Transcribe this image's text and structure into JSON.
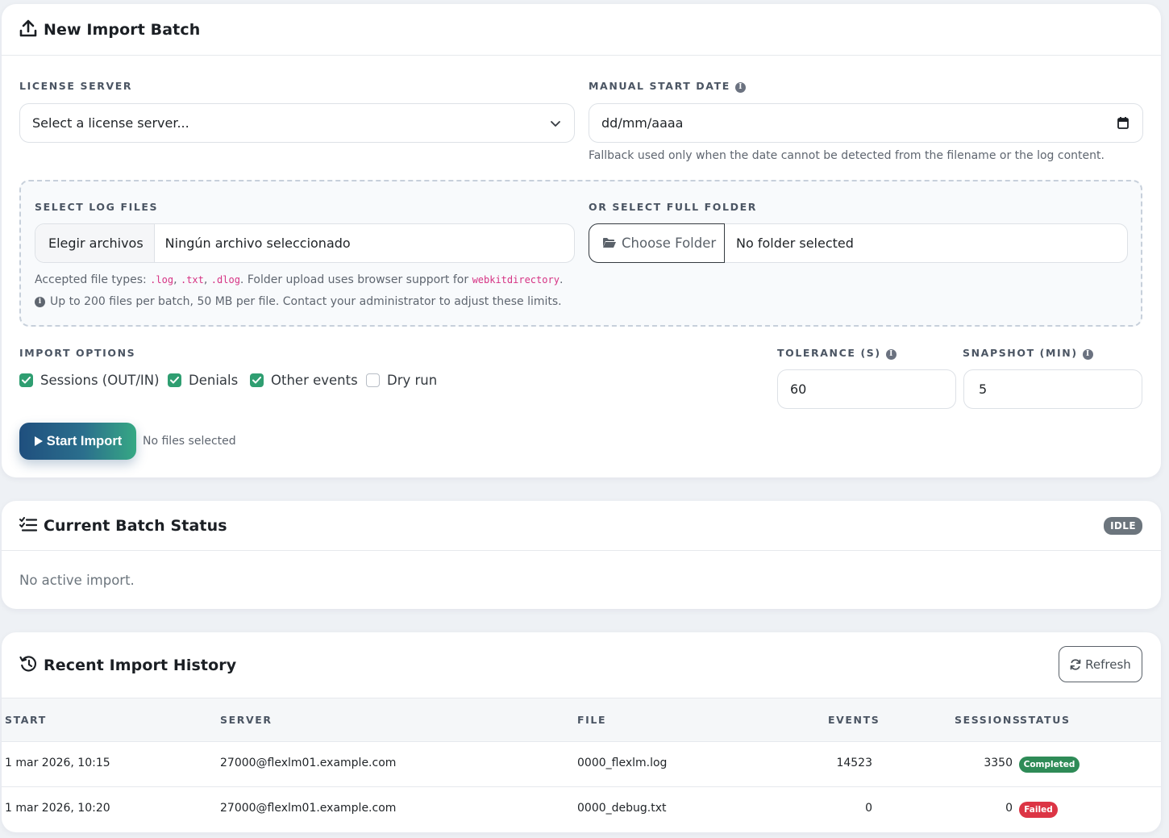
{
  "import_card": {
    "title": "New Import Batch",
    "license_server": {
      "label": "LICENSE SERVER",
      "placeholder": "Select a license server..."
    },
    "manual_start_date": {
      "label": "MANUAL START DATE",
      "placeholder": "dd/mm/aaaa",
      "help": "Fallback used only when the date cannot be detected from the filename or the log content."
    },
    "log_files": {
      "label": "SELECT LOG FILES",
      "button": "Elegir archivos",
      "status": "Ningún archivo seleccionado"
    },
    "folder": {
      "label": "OR SELECT FULL FOLDER",
      "button": "Choose Folder",
      "status": "No folder selected"
    },
    "accepted": {
      "prefix": "Accepted file types: ",
      "types": [
        ".log",
        ".txt",
        ".dlog"
      ],
      "sep1": ", ",
      "sep2": ", ",
      "middle": ". Folder upload uses browser support for ",
      "api": "webkitdirectory",
      "suffix": "."
    },
    "limits": "Up to 200 files per batch, 50 MB per file. Contact your administrator to adjust these limits.",
    "options": {
      "label": "IMPORT OPTIONS",
      "items": [
        {
          "label": "Sessions (OUT/IN)",
          "checked": true
        },
        {
          "label": "Denials",
          "checked": true
        },
        {
          "label": "Other events",
          "checked": true
        },
        {
          "label": "Dry run",
          "checked": false
        }
      ]
    },
    "tolerance": {
      "label": "TOLERANCE (S)",
      "value": "60"
    },
    "snapshot": {
      "label": "SNAPSHOT (MIN)",
      "value": "5"
    },
    "start_button": "Start Import",
    "start_status": "No files selected"
  },
  "status_card": {
    "title": "Current Batch Status",
    "badge": "IDLE",
    "message": "No active import."
  },
  "history_card": {
    "title": "Recent Import History",
    "refresh": "Refresh",
    "columns": [
      "START",
      "SERVER",
      "FILE",
      "EVENTS",
      "SESSIONS",
      "STATUS"
    ],
    "rows": [
      {
        "start": "1 mar 2026, 10:15",
        "server": "27000@flexlm01.example.com",
        "file": "0000_flexlm.log",
        "events": "14523",
        "sessions": "3350",
        "status": "Completed"
      },
      {
        "start": "1 mar 2026, 10:20",
        "server": "27000@flexlm01.example.com",
        "file": "0000_debug.txt",
        "events": "0",
        "sessions": "0",
        "status": "Failed"
      }
    ]
  },
  "colors": {
    "accent_green": "#2f9e71",
    "completed": "#2e8b57",
    "failed": "#dc3545",
    "idle": "#6c757d",
    "button_start": "#1f4f7e",
    "button_end": "#36a884"
  }
}
